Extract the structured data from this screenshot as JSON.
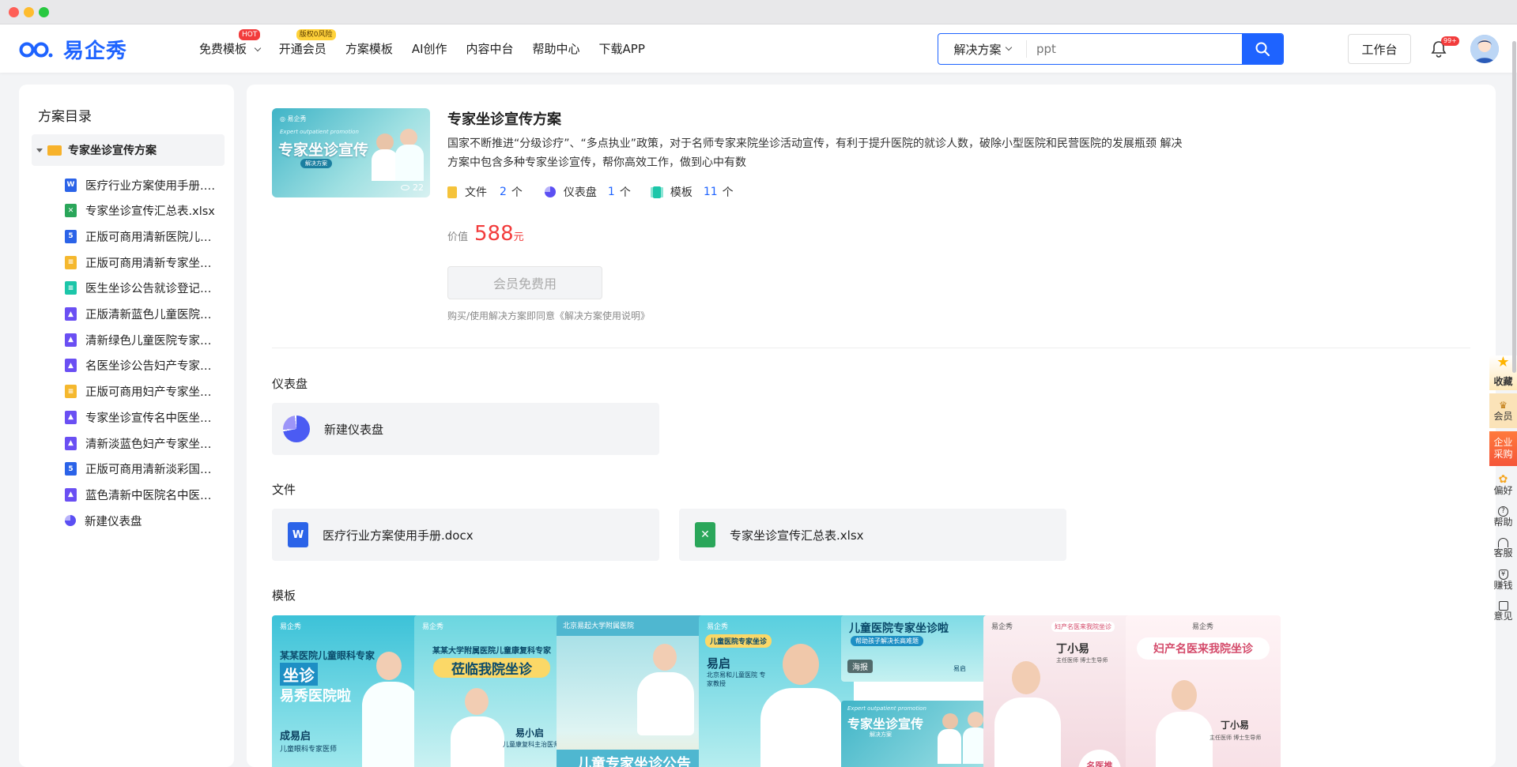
{
  "header": {
    "logo_text": "易企秀",
    "nav": [
      {
        "label": "免费模板",
        "badge": "HOT",
        "badge_color": "#f23c3c"
      },
      {
        "label": "开通会员",
        "badge": "版权0风险",
        "badge_color": "#ffd23a"
      },
      {
        "label": "方案模板"
      },
      {
        "label": "AI创作"
      },
      {
        "label": "内容中台"
      },
      {
        "label": "帮助中心"
      },
      {
        "label": "下载APP"
      }
    ],
    "search": {
      "type": "解决方案",
      "placeholder": "ppt"
    },
    "workbench": "工作台",
    "notification_count": "99+"
  },
  "sidebar": {
    "title": "方案目录",
    "root": "专家坐诊宣传方案",
    "items": [
      {
        "label": "医疗行业方案使用手册.…",
        "icon": "word-icon",
        "color": "#2b63e8"
      },
      {
        "label": "专家坐诊宣传汇总表.xlsx",
        "icon": "excel-icon",
        "color": "#2aa65a"
      },
      {
        "label": "正版可商用清新医院儿…",
        "icon": "h5-icon",
        "color": "#2b63e8"
      },
      {
        "label": "正版可商用清新专家坐…",
        "icon": "doc-icon",
        "color": "#f5b82e"
      },
      {
        "label": "医生坐诊公告就诊登记…",
        "icon": "form-icon",
        "color": "#1cc6a9"
      },
      {
        "label": "正版清新蓝色儿童医院…",
        "icon": "image-icon",
        "color": "#6a4ff3"
      },
      {
        "label": "清新绿色儿童医院专家…",
        "icon": "image-icon",
        "color": "#6a4ff3"
      },
      {
        "label": "名医坐诊公告妇产专家…",
        "icon": "image-icon",
        "color": "#6a4ff3"
      },
      {
        "label": "正版可商用妇产专家坐…",
        "icon": "doc-icon",
        "color": "#f5b82e"
      },
      {
        "label": "专家坐诊宣传名中医坐…",
        "icon": "image-icon",
        "color": "#6a4ff3"
      },
      {
        "label": "清新淡蓝色妇产专家坐…",
        "icon": "image-icon",
        "color": "#6a4ff3"
      },
      {
        "label": "正版可商用清新淡彩国…",
        "icon": "h5-icon",
        "color": "#2b63e8"
      },
      {
        "label": "蓝色清新中医院名中医…",
        "icon": "image-icon",
        "color": "#6a4ff3"
      },
      {
        "label": "新建仪表盘",
        "icon": "dashboard-icon",
        "color": "#5b4ff3"
      }
    ]
  },
  "main": {
    "cover": {
      "title": "专家坐诊宣传",
      "subtitle": "解决方案",
      "en": "Expert outpatient promotion",
      "views": "22"
    },
    "title": "专家坐诊宣传方案",
    "desc": "国家不断推进“分级诊疗”、“多点执业”政策，对于名师专家来院坐诊活动宣传，有利于提升医院的就诊人数，破除小型医院和民营医院的发展瓶颈 解决方案中包含多种专家坐诊宣传，帮你高效工作，做到心中有数",
    "stats": [
      {
        "label": "文件",
        "count": "2",
        "unit": "个"
      },
      {
        "label": "仪表盘",
        "count": "1",
        "unit": "个"
      },
      {
        "label": "模板",
        "count": "11",
        "unit": "个"
      }
    ],
    "price_label": "价值",
    "price": "588",
    "price_unit": "元",
    "free_button": "会员免费用",
    "agreement": "购买/使用解决方案即同意《解决方案使用说明》",
    "dashboard_section": "仪表盘",
    "dashboard_card": "新建仪表盘",
    "files_section": "文件",
    "files": [
      "医疗行业方案使用手册.docx",
      "专家坐诊宣传汇总表.xlsx"
    ],
    "templates_section": "模板",
    "templates": [
      {
        "brand": "易企秀",
        "line1": "某某医院儿童眼科专家",
        "line2": "坐诊",
        "line3": "易秀医院啦",
        "name": "成易启",
        "role": "儿童眼科专家医师",
        "bg": "#47c7d9"
      },
      {
        "brand": "易企秀",
        "line1": "某某大学附属医院儿童康复科专家",
        "line2": "莅临我院坐诊",
        "name": "易小启",
        "role": "儿童康复科主治医师",
        "bg": "#7fdce0"
      },
      {
        "brand": "北京易起大学附属医院",
        "line1": "儿童专家坐诊公告",
        "bg": "#a9e3e8"
      },
      {
        "brand": "易企秀",
        "line1": "儿童医院专家坐诊",
        "name": "易启",
        "role": "北京易和儿童医院 专家教授",
        "bg": "#6fd3e0"
      },
      {
        "line1": "儿童医院专家坐诊啦",
        "line2": "帮助孩子解决长高难题",
        "tag": "海报",
        "name": "易启",
        "line3": "专家坐诊宣传",
        "sub": "解决方案",
        "en": "Expert outpatient promotion",
        "bg": "#6fd3e0"
      },
      {
        "brand": "易企秀",
        "line1": "妇产名医来我院坐诊",
        "name": "丁小易",
        "role": "主任医师 博士生导师",
        "badge": "名医推荐",
        "bg": "#f2dde3"
      },
      {
        "brand": "易企秀",
        "line1": "妇产名医来我院坐诊",
        "name": "丁小易",
        "role": "主任医师 博士生导师",
        "bg": "#f6e6ea"
      }
    ]
  },
  "right_bar": [
    {
      "label": "收藏",
      "icon": "star-icon"
    },
    {
      "label": "会员",
      "icon": "crown-icon"
    },
    {
      "label": "企业采购",
      "icon": "enterprise-icon"
    },
    {
      "label": "偏好",
      "icon": "gear-icon"
    },
    {
      "label": "帮助",
      "icon": "help-icon"
    },
    {
      "label": "客服",
      "icon": "headset-icon"
    },
    {
      "label": "赚钱",
      "icon": "money-icon"
    },
    {
      "label": "意见",
      "icon": "feedback-icon"
    }
  ]
}
